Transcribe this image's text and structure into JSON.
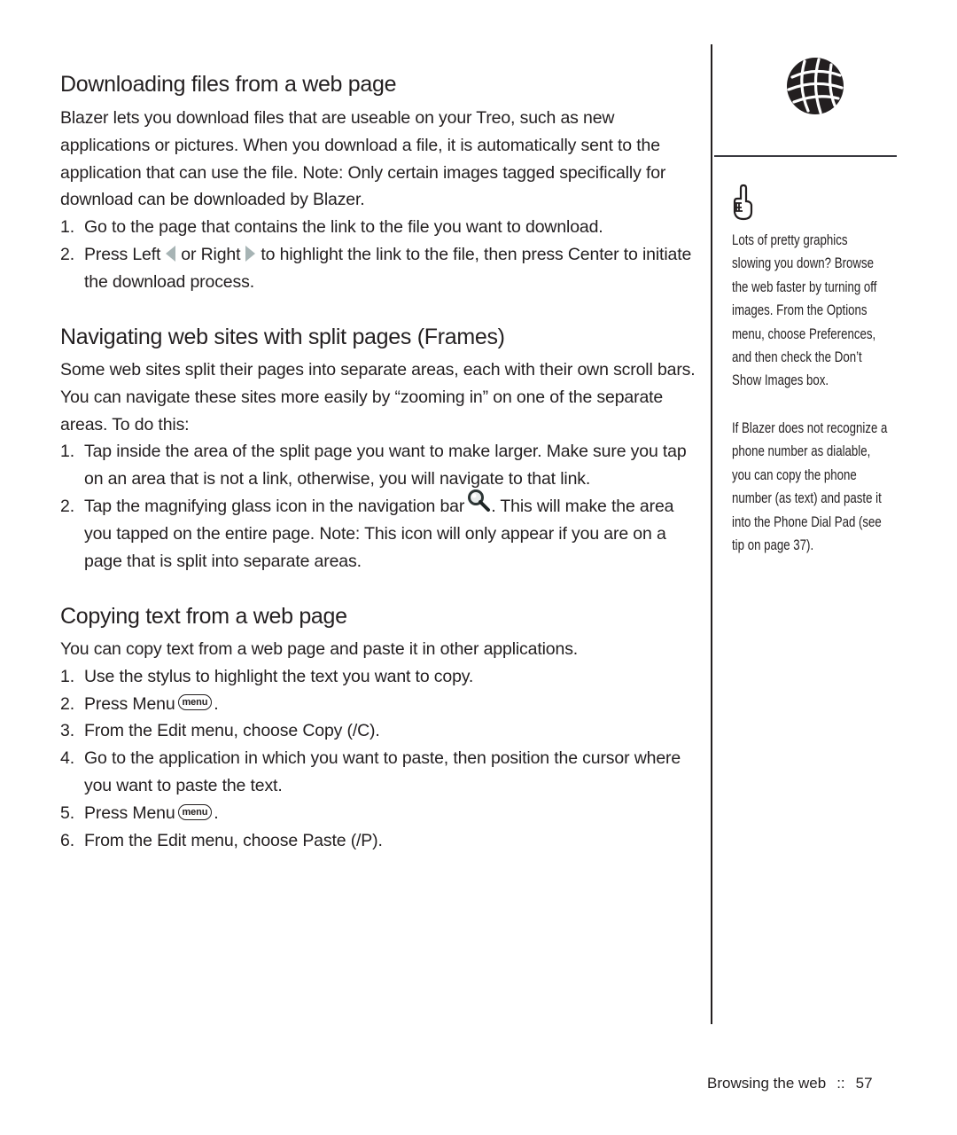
{
  "sections": [
    {
      "title": "Downloading files from a web page",
      "intro": "Blazer lets you download files that are useable on your Treo, such as new applications or pictures. When you download a file, it is automatically sent to the application that can use the file. Note: Only certain images tagged specifically for download can be downloaded by Blazer.",
      "steps": [
        {
          "num": "1.",
          "text": "Go to the page that contains the link to the file you want to download."
        },
        {
          "num": "2.",
          "text_a": "Press Left",
          "text_b": "or Right",
          "text_c": "to highlight the link to the file, then press Center to initiate the download process."
        }
      ]
    },
    {
      "title": "Navigating web sites with split pages (Frames)",
      "intro": "Some web sites split their pages into separate areas, each with their own scroll bars. You can navigate these sites more easily by “zooming in” on one of the separate areas. To do this:",
      "steps": [
        {
          "num": "1.",
          "text": "Tap inside the area of the split page you want to make larger. Make sure you tap on an area that is not a link, otherwise, you will navigate to that link."
        },
        {
          "num": "2.",
          "text_a": "Tap the magnifying glass icon in the navigation bar",
          "text_b": ". This will make the area you tapped on the entire page. Note: This icon will only appear if you are on a page that is split into separate areas."
        }
      ]
    },
    {
      "title": "Copying text from a web page",
      "intro": "You can copy text from a web page and paste it in other applications.",
      "steps": [
        {
          "num": "1.",
          "text": "Use the stylus to highlight the text you want to copy."
        },
        {
          "num": "2.",
          "text_a": "Press Menu",
          "text_b": "."
        },
        {
          "num": "3.",
          "text": "From the Edit menu, choose Copy (/C)."
        },
        {
          "num": "4.",
          "text": "Go to the application in which you want to paste, then position the cursor where you want to paste the text."
        },
        {
          "num": "5.",
          "text_a": "Press Menu",
          "text_b": "."
        },
        {
          "num": "6.",
          "text": "From the Edit menu, choose Paste (/P)."
        }
      ]
    }
  ],
  "menu_key_label": "menu",
  "sidebar": {
    "tip1_lines": [
      "Lots of pretty graphics",
      "slowing you down? Browse",
      "the web faster by turning off",
      "images. From the Options",
      "menu, choose Preferences,",
      "and then check the Don’t",
      "Show Images box."
    ],
    "tip2_lines": [
      "If Blazer does not recognize a",
      "phone number as dialable,",
      "you can copy the phone",
      "number (as text) and paste it",
      "into the Phone Dial Pad (see",
      "tip on page 37)."
    ]
  },
  "footer": {
    "chapter": "Browsing the web",
    "separator": "::",
    "page_number": "57"
  },
  "colors": {
    "text": "#231f20",
    "arrow": "#a7b4b5"
  }
}
